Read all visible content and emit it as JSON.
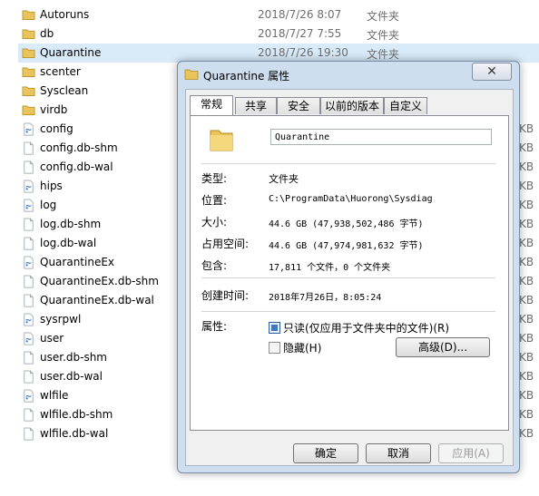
{
  "files": [
    {
      "name": "Autoruns",
      "date": "2018/7/26 8:07",
      "type": "文件夹",
      "size": "",
      "icon": "folder-icon"
    },
    {
      "name": "db",
      "date": "2018/7/27 7:55",
      "type": "文件夹",
      "size": "",
      "icon": "folder-icon"
    },
    {
      "name": "Quarantine",
      "date": "2018/7/26 19:30",
      "type": "文件夹",
      "size": "",
      "icon": "folder-icon",
      "selected": true
    },
    {
      "name": "scenter",
      "date": "",
      "type": "",
      "size": "",
      "icon": "folder-icon"
    },
    {
      "name": "Sysclean",
      "date": "",
      "type": "",
      "size": "",
      "icon": "folder-icon"
    },
    {
      "name": "virdb",
      "date": "",
      "type": "",
      "size": "",
      "icon": "folder-icon"
    },
    {
      "name": "config",
      "date": "",
      "type": "",
      "size": "KB",
      "icon": "db-file-icon"
    },
    {
      "name": "config.db-shm",
      "date": "",
      "type": "",
      "size": "KB",
      "icon": "blank-file-icon"
    },
    {
      "name": "config.db-wal",
      "date": "",
      "type": "",
      "size": "KB",
      "icon": "blank-file-icon"
    },
    {
      "name": "hips",
      "date": "",
      "type": "",
      "size": "KB",
      "icon": "db-file-icon"
    },
    {
      "name": "log",
      "date": "",
      "type": "",
      "size": "KB",
      "icon": "db-file-icon"
    },
    {
      "name": "log.db-shm",
      "date": "",
      "type": "",
      "size": "KB",
      "icon": "blank-file-icon"
    },
    {
      "name": "log.db-wal",
      "date": "",
      "type": "",
      "size": "KB",
      "icon": "blank-file-icon"
    },
    {
      "name": "QuarantineEx",
      "date": "",
      "type": "",
      "size": "KB",
      "icon": "db-file-icon"
    },
    {
      "name": "QuarantineEx.db-shm",
      "date": "",
      "type": "",
      "size": "KB",
      "icon": "blank-file-icon"
    },
    {
      "name": "QuarantineEx.db-wal",
      "date": "",
      "type": "",
      "size": "KB",
      "icon": "blank-file-icon"
    },
    {
      "name": "sysrpwl",
      "date": "",
      "type": "",
      "size": "KB",
      "icon": "db-file-icon"
    },
    {
      "name": "user",
      "date": "",
      "type": "",
      "size": "KB",
      "icon": "db-file-icon"
    },
    {
      "name": "user.db-shm",
      "date": "",
      "type": "",
      "size": "KB",
      "icon": "blank-file-icon"
    },
    {
      "name": "user.db-wal",
      "date": "",
      "type": "",
      "size": "KB",
      "icon": "blank-file-icon"
    },
    {
      "name": "wlfile",
      "date": "",
      "type": "",
      "size": "KB",
      "icon": "db-file-icon"
    },
    {
      "name": "wlfile.db-shm",
      "date": "",
      "type": "",
      "size": "KB",
      "icon": "blank-file-icon"
    },
    {
      "name": "wlfile.db-wal",
      "date": "",
      "type": "",
      "size": "KB",
      "icon": "blank-file-icon"
    }
  ],
  "dialog": {
    "title": "Quarantine 属性",
    "close_label": "✕",
    "tabs": [
      "常规",
      "共享",
      "安全",
      "以前的版本",
      "自定义"
    ],
    "active_tab": "常规",
    "folder_name": "Quarantine",
    "props": [
      {
        "label": "类型:",
        "value": "文件夹"
      },
      {
        "label": "位置:",
        "value": "C:\\ProgramData\\Huorong\\Sysdiag"
      },
      {
        "label": "大小:",
        "value": "44.6 GB (47,938,502,486 字节)"
      },
      {
        "label": "占用空间:",
        "value": "44.6 GB (47,974,981,632 字节)"
      },
      {
        "label": "包含:",
        "value": "17,811 个文件，0 个文件夹"
      }
    ],
    "created_label": "创建时间:",
    "created_value": "2018年7月26日，8:05:24",
    "attributes_label": "属性:",
    "readonly_label": "只读(仅应用于文件夹中的文件)(R)",
    "readonly_checked": true,
    "hidden_label": "隐藏(H)",
    "hidden_checked": false,
    "advanced_label": "高级(D)...",
    "ok_label": "确定",
    "cancel_label": "取消",
    "apply_label": "应用(A)"
  },
  "colors": {
    "selection": "#d9ebf9",
    "folder": "#e8c45a",
    "dialog_frame": "#cfdeef"
  }
}
